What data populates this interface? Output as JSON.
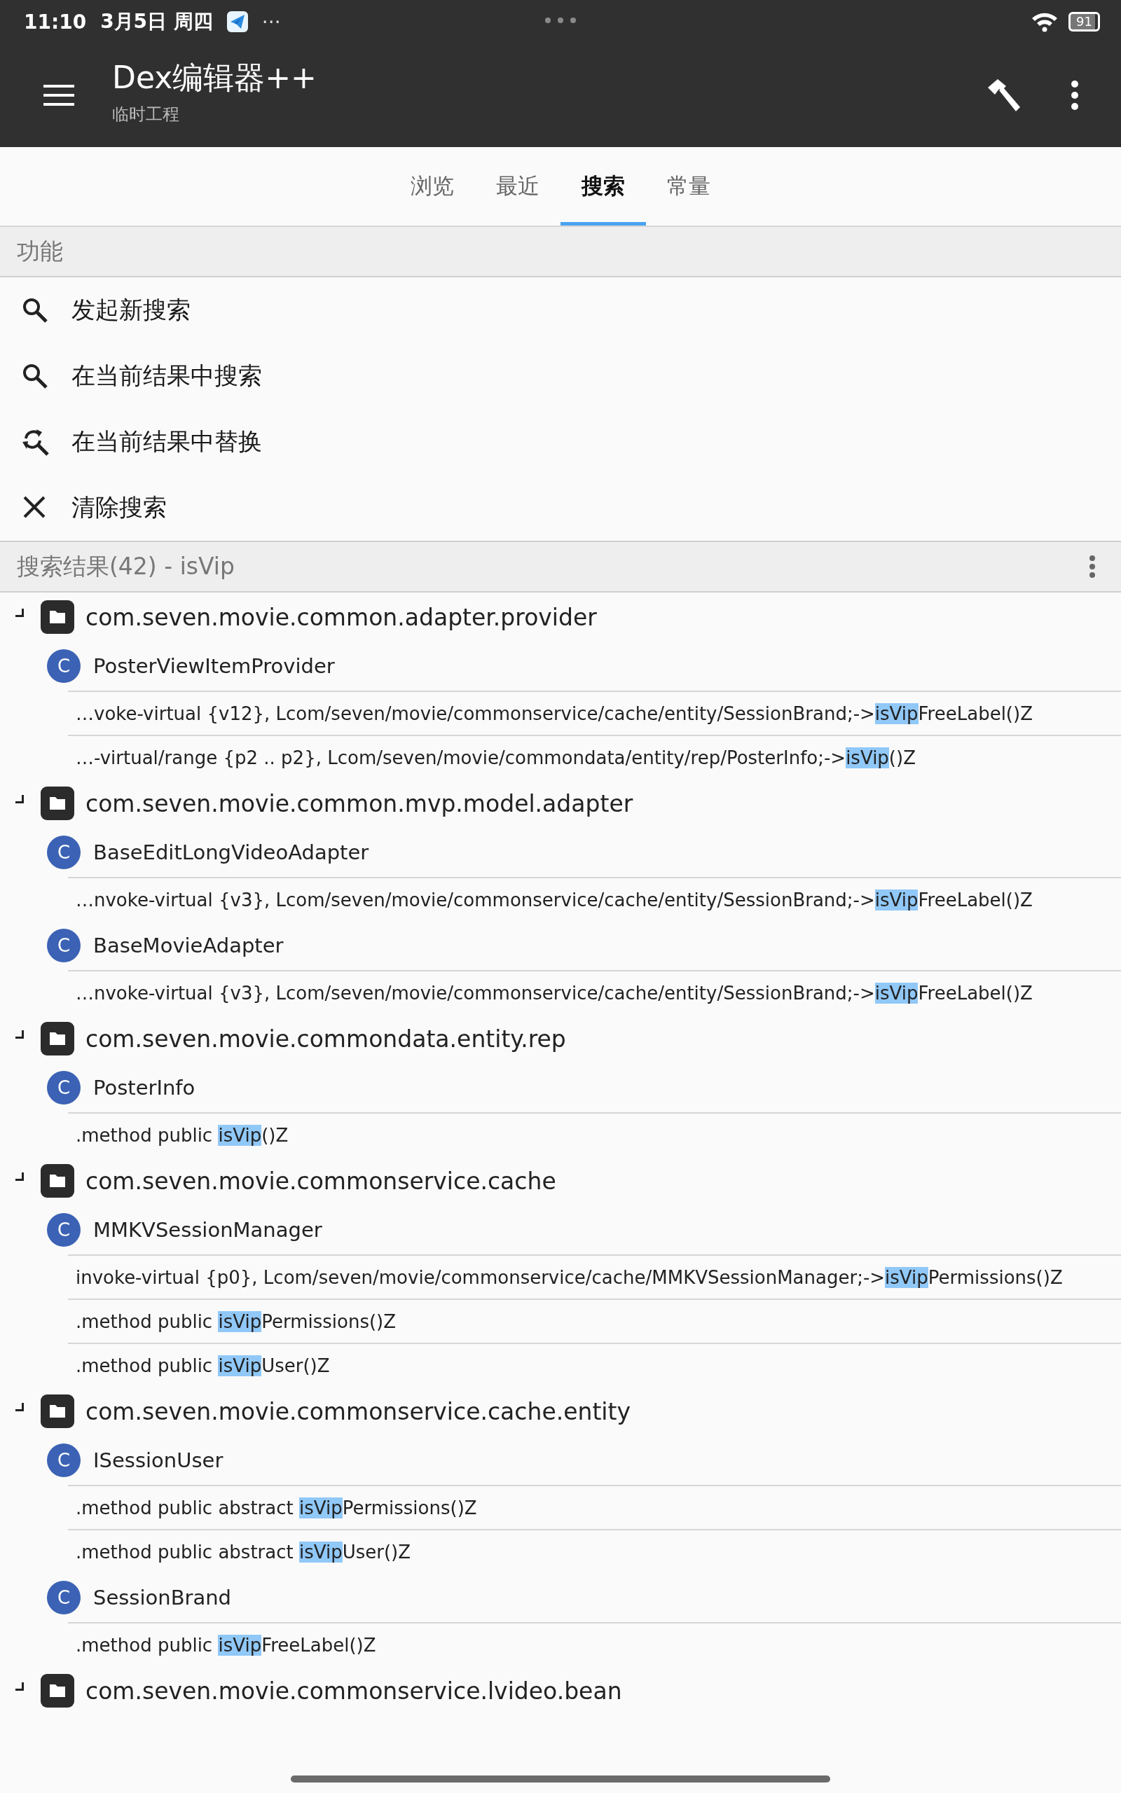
{
  "status_bar": {
    "time": "11:10",
    "date": "3月5日 周四",
    "more": "···",
    "battery": "91"
  },
  "app_bar": {
    "title": "Dex编辑器++",
    "subtitle": "临时工程"
  },
  "tabs": [
    {
      "label": "浏览",
      "selected": false
    },
    {
      "label": "最近",
      "selected": false
    },
    {
      "label": "搜索",
      "selected": true
    },
    {
      "label": "常量",
      "selected": false
    }
  ],
  "functions": {
    "header": "功能",
    "items": [
      {
        "kind": "search",
        "label": "发起新搜索"
      },
      {
        "kind": "search",
        "label": "在当前结果中搜索"
      },
      {
        "kind": "replace",
        "label": "在当前结果中替换"
      },
      {
        "kind": "clear",
        "label": "清除搜索"
      }
    ]
  },
  "results": {
    "header": "搜索结果(42) - isVip",
    "packages": [
      {
        "name": "com.seven.movie.common.adapter.provider",
        "expanded": true,
        "classes": [
          {
            "badge": "C",
            "name": "PosterViewItemProvider",
            "results": [
              {
                "prefix": "…voke-virtual {v12}, Lcom/seven/movie/commonservice/cache/entity/SessionBrand;->",
                "match": "isVip",
                "suffix": "FreeLabel()Z"
              },
              {
                "prefix": "…-virtual/range {p2 .. p2}, Lcom/seven/movie/commondata/entity/rep/PosterInfo;->",
                "match": "isVip",
                "suffix": "()Z"
              }
            ]
          }
        ]
      },
      {
        "name": "com.seven.movie.common.mvp.model.adapter",
        "expanded": true,
        "classes": [
          {
            "badge": "C",
            "name": "BaseEditLongVideoAdapter",
            "results": [
              {
                "prefix": "…nvoke-virtual {v3}, Lcom/seven/movie/commonservice/cache/entity/SessionBrand;->",
                "match": "isVip",
                "suffix": "FreeLabel()Z"
              }
            ]
          },
          {
            "badge": "C",
            "name": "BaseMovieAdapter",
            "results": [
              {
                "prefix": "…nvoke-virtual {v3}, Lcom/seven/movie/commonservice/cache/entity/SessionBrand;->",
                "match": "isVip",
                "suffix": "FreeLabel()Z"
              }
            ]
          }
        ]
      },
      {
        "name": "com.seven.movie.commondata.entity.rep",
        "expanded": true,
        "classes": [
          {
            "badge": "C",
            "name": "PosterInfo",
            "results": [
              {
                "prefix": ".method public ",
                "match": "isVip",
                "suffix": "()Z"
              }
            ]
          }
        ]
      },
      {
        "name": "com.seven.movie.commonservice.cache",
        "expanded": true,
        "classes": [
          {
            "badge": "C",
            "name": "MMKVSessionManager",
            "results": [
              {
                "prefix": "invoke-virtual {p0}, Lcom/seven/movie/commonservice/cache/MMKVSessionManager;->",
                "match": "isVip",
                "suffix": "Permissions()Z"
              },
              {
                "prefix": ".method public ",
                "match": "isVip",
                "suffix": "Permissions()Z"
              },
              {
                "prefix": ".method public ",
                "match": "isVip",
                "suffix": "User()Z"
              }
            ]
          }
        ]
      },
      {
        "name": "com.seven.movie.commonservice.cache.entity",
        "expanded": true,
        "classes": [
          {
            "badge": "C",
            "name": "ISessionUser",
            "results": [
              {
                "prefix": ".method public abstract ",
                "match": "isVip",
                "suffix": "Permissions()Z"
              },
              {
                "prefix": ".method public abstract ",
                "match": "isVip",
                "suffix": "User()Z"
              }
            ]
          },
          {
            "badge": "C",
            "name": "SessionBrand",
            "results": [
              {
                "prefix": ".method public ",
                "match": "isVip",
                "suffix": "FreeLabel()Z"
              }
            ]
          }
        ]
      },
      {
        "name": "com.seven.movie.commonservice.lvideo.bean",
        "expanded": true
      }
    ]
  }
}
